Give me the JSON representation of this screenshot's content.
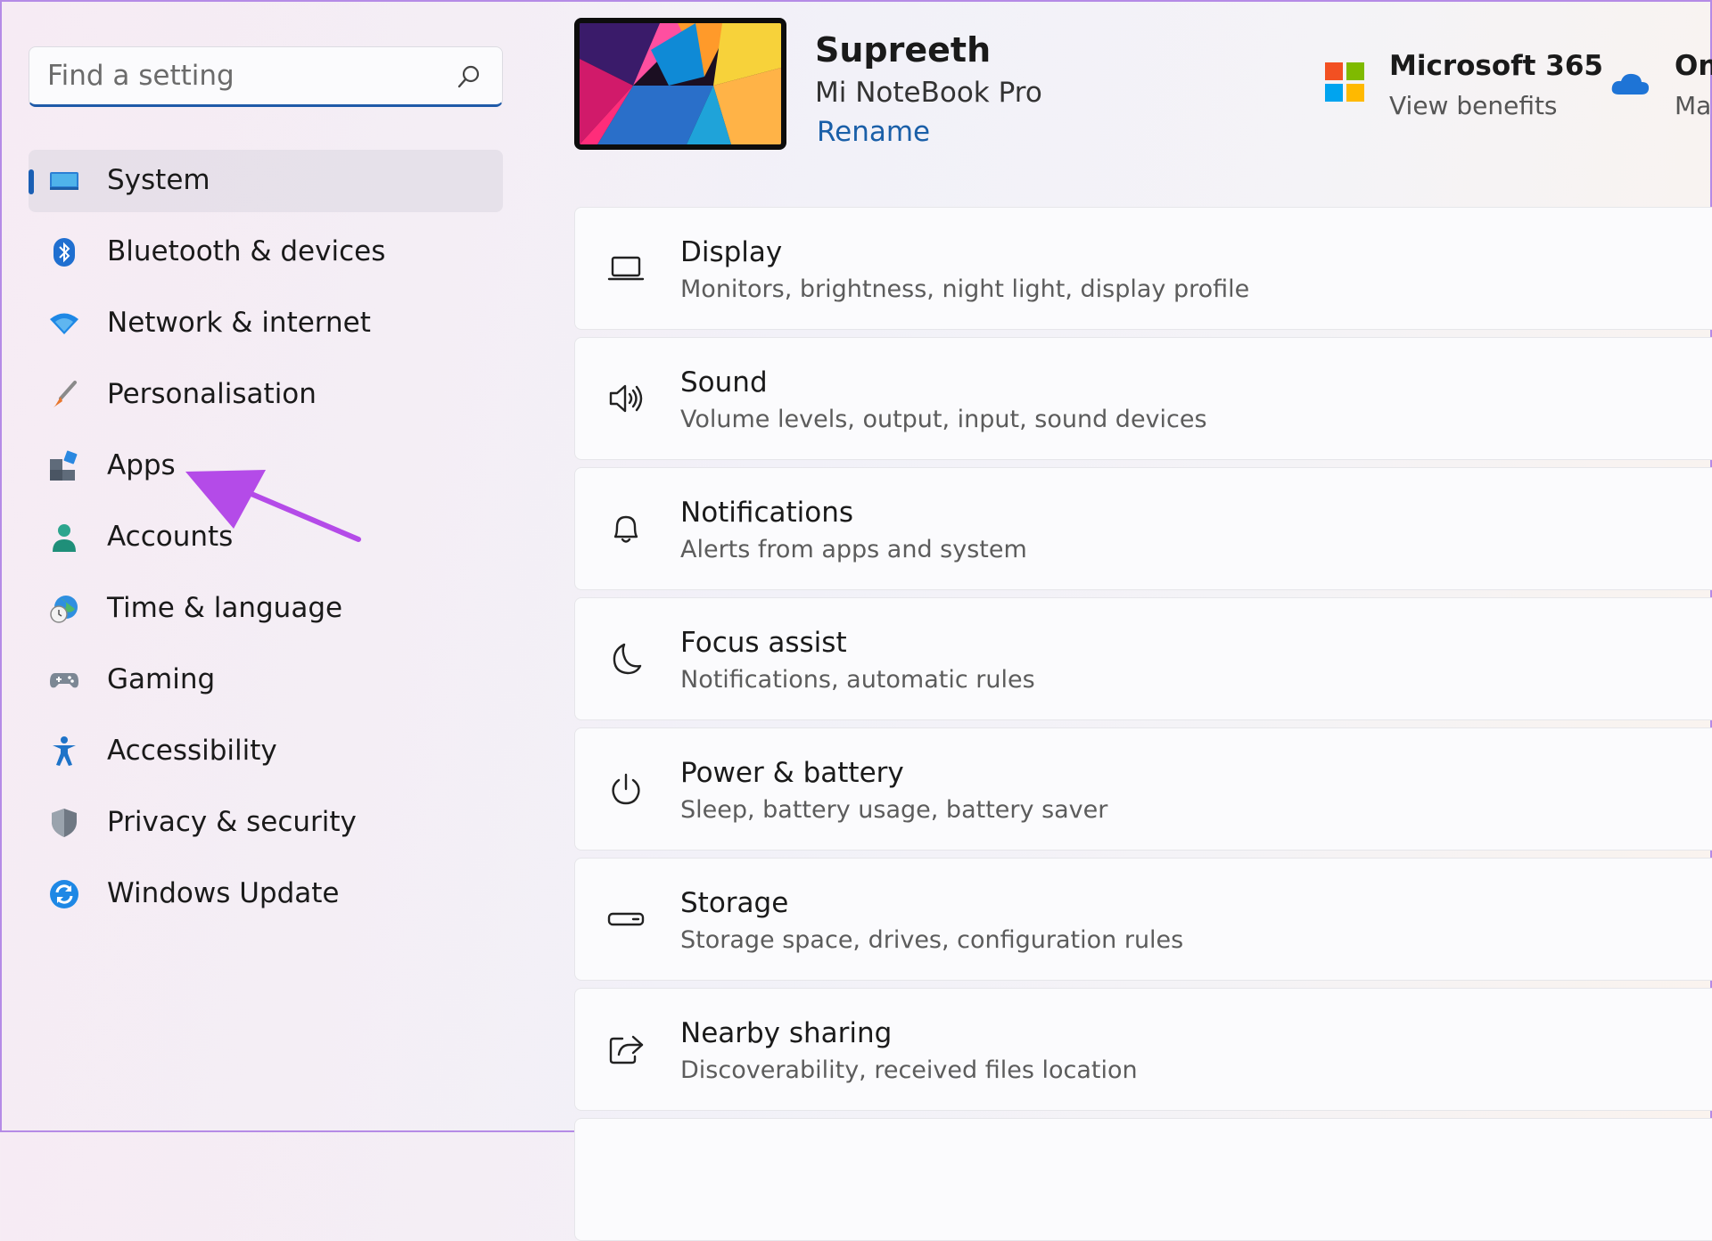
{
  "search": {
    "placeholder": "Find a setting"
  },
  "sidebar": {
    "items": [
      {
        "label": "System",
        "icon": "system-icon",
        "active": true
      },
      {
        "label": "Bluetooth & devices",
        "icon": "bluetooth-icon"
      },
      {
        "label": "Network & internet",
        "icon": "wifi-icon"
      },
      {
        "label": "Personalisation",
        "icon": "paintbrush-icon"
      },
      {
        "label": "Apps",
        "icon": "apps-icon"
      },
      {
        "label": "Accounts",
        "icon": "person-icon"
      },
      {
        "label": "Time & language",
        "icon": "globe-clock-icon"
      },
      {
        "label": "Gaming",
        "icon": "gamepad-icon"
      },
      {
        "label": "Accessibility",
        "icon": "accessibility-icon"
      },
      {
        "label": "Privacy & security",
        "icon": "shield-icon"
      },
      {
        "label": "Windows Update",
        "icon": "update-icon"
      }
    ]
  },
  "header": {
    "device_name": "Supreeth",
    "device_model": "Mi NoteBook Pro",
    "rename_label": "Rename",
    "microsoft365": {
      "title": "Microsoft 365",
      "link": "View benefits",
      "icon": "microsoft-logo-icon"
    },
    "onedrive": {
      "title": "On",
      "subtitle": "Ma",
      "icon": "onedrive-cloud-icon"
    }
  },
  "settings": [
    {
      "title": "Display",
      "subtitle": "Monitors, brightness, night light, display profile",
      "icon": "laptop-icon"
    },
    {
      "title": "Sound",
      "subtitle": "Volume levels, output, input, sound devices",
      "icon": "speaker-icon"
    },
    {
      "title": "Notifications",
      "subtitle": "Alerts from apps and system",
      "icon": "bell-icon"
    },
    {
      "title": "Focus assist",
      "subtitle": "Notifications, automatic rules",
      "icon": "moon-icon"
    },
    {
      "title": "Power & battery",
      "subtitle": "Sleep, battery usage, battery saver",
      "icon": "power-icon"
    },
    {
      "title": "Storage",
      "subtitle": "Storage space, drives, configuration rules",
      "icon": "drive-icon"
    },
    {
      "title": "Nearby sharing",
      "subtitle": "Discoverability, received files location",
      "icon": "share-icon"
    }
  ],
  "colors": {
    "accent": "#1a5fb4",
    "annotation_arrow": "#b44be8"
  }
}
